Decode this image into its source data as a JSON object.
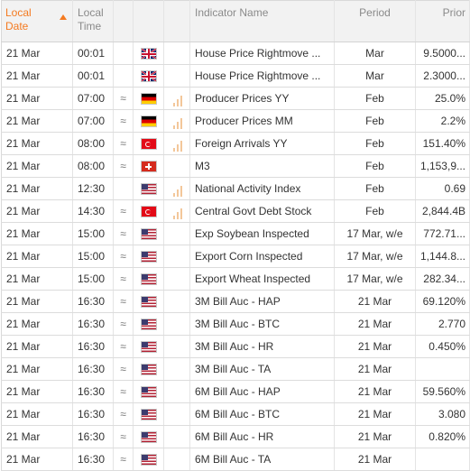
{
  "header": {
    "date_line1": "Local",
    "date_line2": "Date",
    "time_line1": "Local",
    "time_line2": "Time",
    "indicator_name": "Indicator Name",
    "period": "Period",
    "prior": "Prior"
  },
  "colors": {
    "sort_accent": "#f47a20",
    "volatility_bars": "#f3c79a"
  },
  "rows": [
    {
      "date": "21 Mar",
      "time": "00:01",
      "approx": "",
      "flag": "uk-flag-icon",
      "volatility": 0,
      "name": "House Price Rightmove ...",
      "period": "Mar",
      "prior": "9.5000..."
    },
    {
      "date": "21 Mar",
      "time": "00:01",
      "approx": "",
      "flag": "uk-flag-icon",
      "volatility": 0,
      "name": "House Price Rightmove ...",
      "period": "Mar",
      "prior": "2.3000..."
    },
    {
      "date": "21 Mar",
      "time": "07:00",
      "approx": "≈",
      "flag": "de-flag-icon",
      "volatility": 3,
      "name": "Producer Prices YY",
      "period": "Feb",
      "prior": "25.0%"
    },
    {
      "date": "21 Mar",
      "time": "07:00",
      "approx": "≈",
      "flag": "de-flag-icon",
      "volatility": 3,
      "name": "Producer Prices MM",
      "period": "Feb",
      "prior": "2.2%"
    },
    {
      "date": "21 Mar",
      "time": "08:00",
      "approx": "≈",
      "flag": "tr-flag-icon",
      "volatility": 3,
      "name": "Foreign Arrivals YY",
      "period": "Feb",
      "prior": "151.40%"
    },
    {
      "date": "21 Mar",
      "time": "08:00",
      "approx": "≈",
      "flag": "ch-flag-icon",
      "volatility": 0,
      "name": "M3",
      "period": "Feb",
      "prior": "1,153,9..."
    },
    {
      "date": "21 Mar",
      "time": "12:30",
      "approx": "",
      "flag": "us-flag-icon",
      "volatility": 3,
      "name": "National Activity Index",
      "period": "Feb",
      "prior": "0.69"
    },
    {
      "date": "21 Mar",
      "time": "14:30",
      "approx": "≈",
      "flag": "tr-flag-icon",
      "volatility": 3,
      "name": "Central Govt Debt Stock",
      "period": "Feb",
      "prior": "2,844.4B"
    },
    {
      "date": "21 Mar",
      "time": "15:00",
      "approx": "≈",
      "flag": "us-flag-icon",
      "volatility": 0,
      "name": "Exp Soybean Inspected",
      "period": "17 Mar, w/e",
      "prior": "772.71..."
    },
    {
      "date": "21 Mar",
      "time": "15:00",
      "approx": "≈",
      "flag": "us-flag-icon",
      "volatility": 0,
      "name": "Export Corn Inspected",
      "period": "17 Mar, w/e",
      "prior": "1,144.8..."
    },
    {
      "date": "21 Mar",
      "time": "15:00",
      "approx": "≈",
      "flag": "us-flag-icon",
      "volatility": 0,
      "name": "Export Wheat Inspected",
      "period": "17 Mar, w/e",
      "prior": "282.34..."
    },
    {
      "date": "21 Mar",
      "time": "16:30",
      "approx": "≈",
      "flag": "us-flag-icon",
      "volatility": 0,
      "name": "3M Bill Auc - HAP",
      "period": "21 Mar",
      "prior": "69.120%"
    },
    {
      "date": "21 Mar",
      "time": "16:30",
      "approx": "≈",
      "flag": "us-flag-icon",
      "volatility": 0,
      "name": "3M Bill Auc - BTC",
      "period": "21 Mar",
      "prior": "2.770"
    },
    {
      "date": "21 Mar",
      "time": "16:30",
      "approx": "≈",
      "flag": "us-flag-icon",
      "volatility": 0,
      "name": "3M Bill Auc - HR",
      "period": "21 Mar",
      "prior": "0.450%"
    },
    {
      "date": "21 Mar",
      "time": "16:30",
      "approx": "≈",
      "flag": "us-flag-icon",
      "volatility": 0,
      "name": "3M Bill Auc - TA",
      "period": "21 Mar",
      "prior": ""
    },
    {
      "date": "21 Mar",
      "time": "16:30",
      "approx": "≈",
      "flag": "us-flag-icon",
      "volatility": 0,
      "name": "6M Bill Auc - HAP",
      "period": "21 Mar",
      "prior": "59.560%"
    },
    {
      "date": "21 Mar",
      "time": "16:30",
      "approx": "≈",
      "flag": "us-flag-icon",
      "volatility": 0,
      "name": "6M Bill Auc - BTC",
      "period": "21 Mar",
      "prior": "3.080"
    },
    {
      "date": "21 Mar",
      "time": "16:30",
      "approx": "≈",
      "flag": "us-flag-icon",
      "volatility": 0,
      "name": "6M Bill Auc - HR",
      "period": "21 Mar",
      "prior": "0.820%"
    },
    {
      "date": "21 Mar",
      "time": "16:30",
      "approx": "≈",
      "flag": "us-flag-icon",
      "volatility": 0,
      "name": "6M Bill Auc - TA",
      "period": "21 Mar",
      "prior": ""
    }
  ]
}
